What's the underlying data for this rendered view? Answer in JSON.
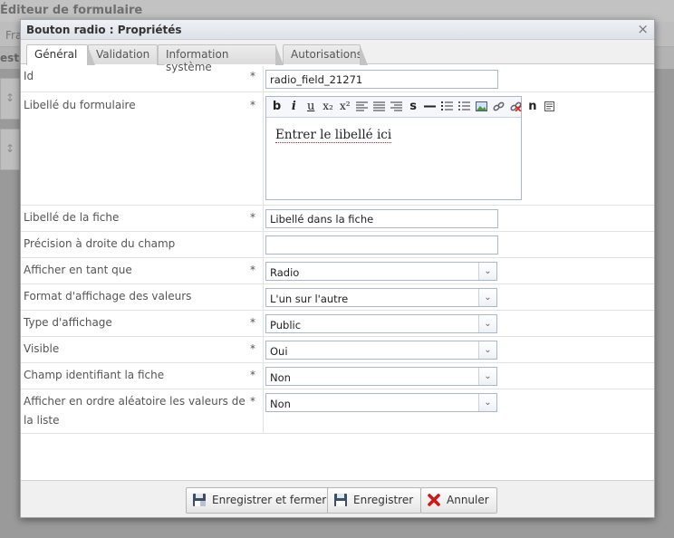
{
  "background": {
    "window_title": "Éditeur de formulaire",
    "toolbar_text": "Fra",
    "section_text": "est",
    "row_handle": "↕"
  },
  "dialog": {
    "title": "Bouton radio : Propriétés",
    "close_label": "×",
    "tabs": [
      {
        "label": "Général",
        "active": true
      },
      {
        "label": "Validation",
        "active": false
      },
      {
        "label": "Information système",
        "active": false
      },
      {
        "label": "Autorisations",
        "active": false
      }
    ]
  },
  "form": {
    "required_mark": "*",
    "id": {
      "label": "Id",
      "value": "radio_field_21271"
    },
    "libelle_formulaire": {
      "label": "Libellé du formulaire",
      "editor_text": "Entrer le libellé ici"
    },
    "libelle_fiche": {
      "label": "Libellé de la fiche",
      "value": "Libellé dans la fiche"
    },
    "precision": {
      "label": "Précision à droite du champ",
      "value": ""
    },
    "afficher_en_tant_que": {
      "label": "Afficher en tant que",
      "value": "Radio"
    },
    "format_affichage": {
      "label": "Format d'affichage des valeurs",
      "value": "L'un sur l'autre"
    },
    "type_affichage": {
      "label": "Type d'affichage",
      "value": "Public"
    },
    "visible": {
      "label": "Visible",
      "value": "Oui"
    },
    "champ_identifiant": {
      "label": "Champ identifiant la fiche",
      "value": "Non"
    },
    "ordre_aleatoire": {
      "label": "Afficher en ordre aléatoire les valeurs de la liste",
      "value": "Non"
    }
  },
  "editor_toolbar": {
    "bold": "b",
    "italic": "i",
    "underline": "u",
    "subscript": "x₂",
    "superscript": "x²",
    "strike": "s",
    "special_char": "n"
  },
  "footer": {
    "save_close_label": "Enregistrer et fermer",
    "save_label": "Enregistrer",
    "cancel_label": "Annuler"
  }
}
